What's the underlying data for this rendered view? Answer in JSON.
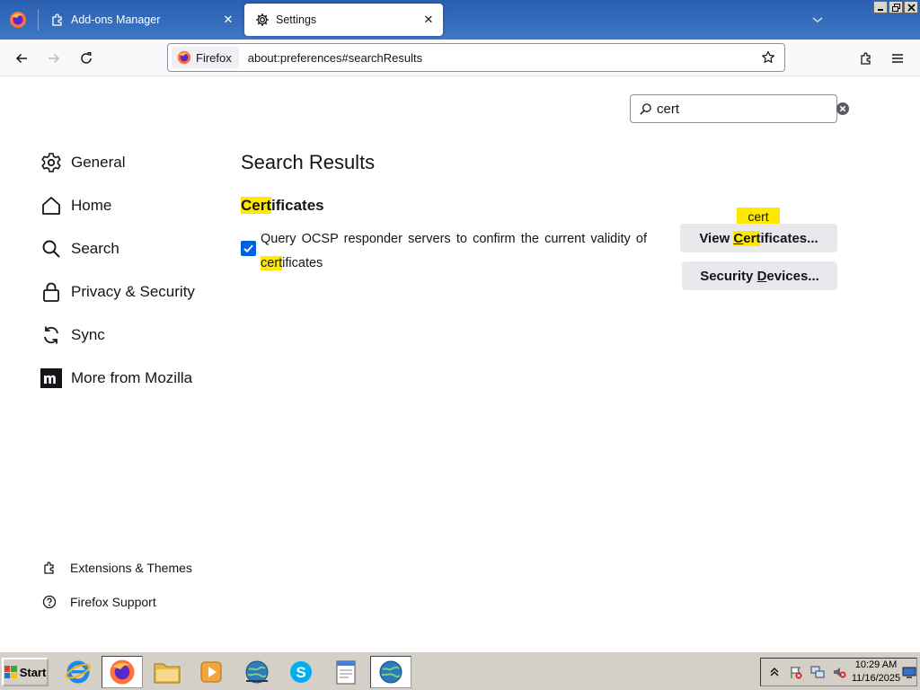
{
  "window": {
    "app_icon": "firefox-icon",
    "controls": [
      "minimize-icon",
      "restore-icon",
      "close-icon"
    ]
  },
  "tabs": [
    {
      "label": "Add-ons Manager",
      "icon": "puzzle-icon",
      "active": false
    },
    {
      "label": "Settings",
      "icon": "gear-icon",
      "active": true
    }
  ],
  "navbar": {
    "identity_label": "Firefox",
    "url": "about:preferences#searchResults"
  },
  "search": {
    "value": "cert"
  },
  "sidebar": {
    "items": [
      {
        "label": "General",
        "icon": "gear-icon"
      },
      {
        "label": "Home",
        "icon": "home-icon"
      },
      {
        "label": "Search",
        "icon": "search-icon"
      },
      {
        "label": "Privacy & Security",
        "icon": "lock-icon"
      },
      {
        "label": "Sync",
        "icon": "sync-icon"
      },
      {
        "label": "More from Mozilla",
        "icon": "mozilla-icon"
      }
    ],
    "footer": [
      {
        "label": "Extensions & Themes",
        "icon": "puzzle-icon"
      },
      {
        "label": "Firefox Support",
        "icon": "help-icon"
      }
    ]
  },
  "results": {
    "title": "Search Results",
    "section": {
      "highlight": "Cert",
      "rest": "ificates"
    },
    "checkbox": {
      "checked": true,
      "text_main": "Query OCSP responder servers to confirm the current validity of ",
      "text_highlight": "cert",
      "text_rest": "ificates"
    },
    "buttons": {
      "view": {
        "pre": "View ",
        "access_key": "C",
        "highlight_rest": "ert",
        "rest": "ificates..."
      },
      "security": {
        "pre": "Security ",
        "access_key": "D",
        "rest": "evices..."
      }
    },
    "tooltip": "cert"
  },
  "taskbar": {
    "start_label": "Start",
    "apps": [
      "internet-explorer-icon",
      "firefox-icon",
      "file-explorer-icon",
      "media-player-icon",
      "network-globe-icon",
      "skype-icon",
      "notepad-icon",
      "network-globe-icon"
    ],
    "tray_icons": [
      "expand-tray-icon",
      "flag-icon",
      "network-icon",
      "volume-muted-icon",
      "monitor-icon"
    ],
    "clock_time": "10:29 AM",
    "clock_date": "11/16/2025"
  },
  "colors": {
    "highlight": "#ffe900",
    "checkbox": "#0061e0",
    "button_bg": "#e9e9ed",
    "titlebar": "#2a5fb0"
  }
}
